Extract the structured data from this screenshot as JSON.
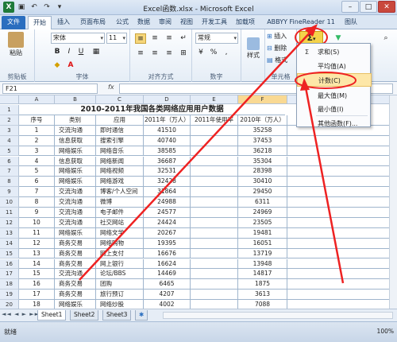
{
  "window": {
    "title": "Excel函数.xlsx - Microsoft Excel",
    "min": "–",
    "max": "□",
    "close": "✕"
  },
  "qat": {
    "logo": "X",
    "save": "▣",
    "undo": "↶",
    "redo": "↷",
    "more": "▾"
  },
  "tabs": [
    "文件",
    "开始",
    "插入",
    "页面布局",
    "公式",
    "数据",
    "审阅",
    "视图",
    "开发工具",
    "加载项",
    "ABBYY FineReader 11",
    "图队"
  ],
  "ribbon": {
    "clipboard": {
      "label": "剪贴板",
      "paste": "粘贴"
    },
    "font": {
      "label": "字体",
      "name": "宋体",
      "size": "11",
      "bold": "B",
      "italic": "I",
      "underline": "U"
    },
    "align": {
      "label": "对齐方式"
    },
    "number": {
      "label": "数字",
      "format": "常规",
      "pct": "%",
      "comma": ","
    },
    "styles": {
      "label": "样式"
    },
    "cells": {
      "label": "单元格",
      "insert": "插入",
      "delete": "删除",
      "format": "格式"
    },
    "editing": {
      "sum": "Σ",
      "sort": "排序和筛选",
      "find": "查找和选择"
    }
  },
  "formula": {
    "namebox": "F21",
    "fx": "fx",
    "value": ""
  },
  "menu": {
    "items": [
      {
        "icon": "Σ",
        "label": "求和(S)"
      },
      {
        "icon": "",
        "label": "平均值(A)"
      },
      {
        "icon": "",
        "label": "计数(C)"
      },
      {
        "icon": "",
        "label": "最大值(M)"
      },
      {
        "icon": "",
        "label": "最小值(I)"
      },
      {
        "icon": "",
        "label": "其他函数(F)..."
      }
    ]
  },
  "columns": [
    "A",
    "B",
    "C",
    "D",
    "E",
    "F",
    "G"
  ],
  "sheet": {
    "title": "2010-2011年我国各类网络应用用户数据",
    "headers": [
      "序号",
      "类别",
      "应用",
      "2011年（万人）",
      "2011年使用率",
      "2010年（万人）",
      "201"
    ],
    "rows": [
      [
        "1",
        "交流沟通",
        "即时通信",
        "41510",
        "",
        "35258"
      ],
      [
        "2",
        "信息获取",
        "搜索引擎",
        "40740",
        "",
        "37453"
      ],
      [
        "3",
        "网络娱乐",
        "网络音乐",
        "38585",
        "",
        "36218"
      ],
      [
        "4",
        "信息获取",
        "网络新闻",
        "36687",
        "",
        "35304"
      ],
      [
        "5",
        "网络娱乐",
        "网络视频",
        "32531",
        "",
        "28398"
      ],
      [
        "6",
        "网络娱乐",
        "网络游戏",
        "32428",
        "",
        "30410"
      ],
      [
        "7",
        "交流沟通",
        "博客/个人空间",
        "31864",
        "",
        "29450"
      ],
      [
        "8",
        "交流沟通",
        "微博",
        "24988",
        "",
        "6311"
      ],
      [
        "9",
        "交流沟通",
        "电子邮件",
        "24577",
        "",
        "24969"
      ],
      [
        "10",
        "交流沟通",
        "社交网站",
        "24424",
        "",
        "23505"
      ],
      [
        "11",
        "网络娱乐",
        "网络文学",
        "20267",
        "",
        "19481"
      ],
      [
        "12",
        "商务交易",
        "网络购物",
        "19395",
        "",
        "16051"
      ],
      [
        "13",
        "商务交易",
        "网上支付",
        "16676",
        "",
        "13719"
      ],
      [
        "14",
        "商务交易",
        "网上银行",
        "16624",
        "",
        "13948"
      ],
      [
        "15",
        "交流沟通",
        "论坛/BBS",
        "14469",
        "",
        "14817"
      ],
      [
        "16",
        "商务交易",
        "团购",
        "6465",
        "",
        "1875"
      ],
      [
        "17",
        "商务交易",
        "旅行预订",
        "4207",
        "",
        "3613"
      ],
      [
        "18",
        "网络娱乐",
        "网络炒股",
        "4002",
        "",
        "7088"
      ]
    ],
    "count_label": "计数"
  },
  "sheettabs": [
    "Sheet1",
    "Sheet2",
    "Sheet3"
  ],
  "navbtns": "◄◄ ◄ ► ►►",
  "status": {
    "ready": "就绪",
    "zoom": "100%"
  },
  "colors": {
    "accent": "#2a6ebf",
    "highlight": "#fde7a8",
    "annotation": "#e22222"
  }
}
